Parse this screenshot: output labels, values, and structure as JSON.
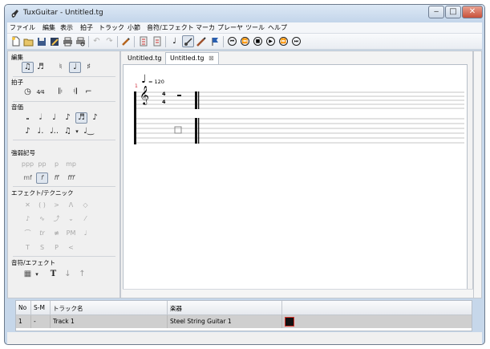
{
  "window": {
    "title": "TuxGuitar - Untitled.tg",
    "app_icon": "guitar-app-icon"
  },
  "caption_buttons": {
    "minimize": "‒",
    "maximize": "□",
    "close": "✕"
  },
  "menu": [
    "ファイル",
    "編集",
    "表示",
    "拍子",
    "トラック",
    "小節",
    "音符/エフェクト",
    "マーカ",
    "プレーヤ",
    "ツール",
    "ヘルプ"
  ],
  "toolbar": {
    "icons": [
      "new-file-icon",
      "open-file-icon",
      "save-icon",
      "save-as-icon",
      "print-icon",
      "print-preview-icon",
      "undo-icon",
      "redo-icon",
      "edit-mode-icon",
      "track-properties-icon",
      "measure-properties-icon",
      "score-view-icon",
      "tablature-view-icon",
      "fretboard-icon",
      "marker-icon",
      "first-icon",
      "previous-icon",
      "stop-icon",
      "play-icon",
      "next-icon",
      "last-icon"
    ]
  },
  "left_panel": {
    "sections": {
      "edit": "編集",
      "beat": "拍子",
      "duration": "音価",
      "dynamics": "強弱記号",
      "effects": "エフェクト/テクニック",
      "note_effects": "音符/エフェクト"
    },
    "dynamics_labels": [
      "ppp",
      "pp",
      "p",
      "mp",
      "mf",
      "f",
      "ff",
      "fff"
    ],
    "effect_labels": [
      "PM",
      "T",
      "S",
      "P"
    ]
  },
  "tabs": [
    {
      "label": "Untitled.tg",
      "active": false
    },
    {
      "label": "Untitled.tg",
      "active": true,
      "close": "⊠"
    }
  ],
  "score": {
    "measure_number": "1",
    "tempo_note": "♩",
    "tempo_value": "= 120",
    "time_signature_top": "4",
    "time_signature_bottom": "4",
    "clef": "𝄞"
  },
  "track_table": {
    "headers": [
      "No",
      "S-M",
      "トラック名",
      "楽器"
    ],
    "rows": [
      {
        "no": "1",
        "sm": "-",
        "name": "Track 1",
        "instrument": "Steel String Guitar 1",
        "color": "#111111"
      }
    ]
  },
  "colors": {
    "selection_border": "#7e8fa6",
    "track_color_border": "#d9342b"
  }
}
